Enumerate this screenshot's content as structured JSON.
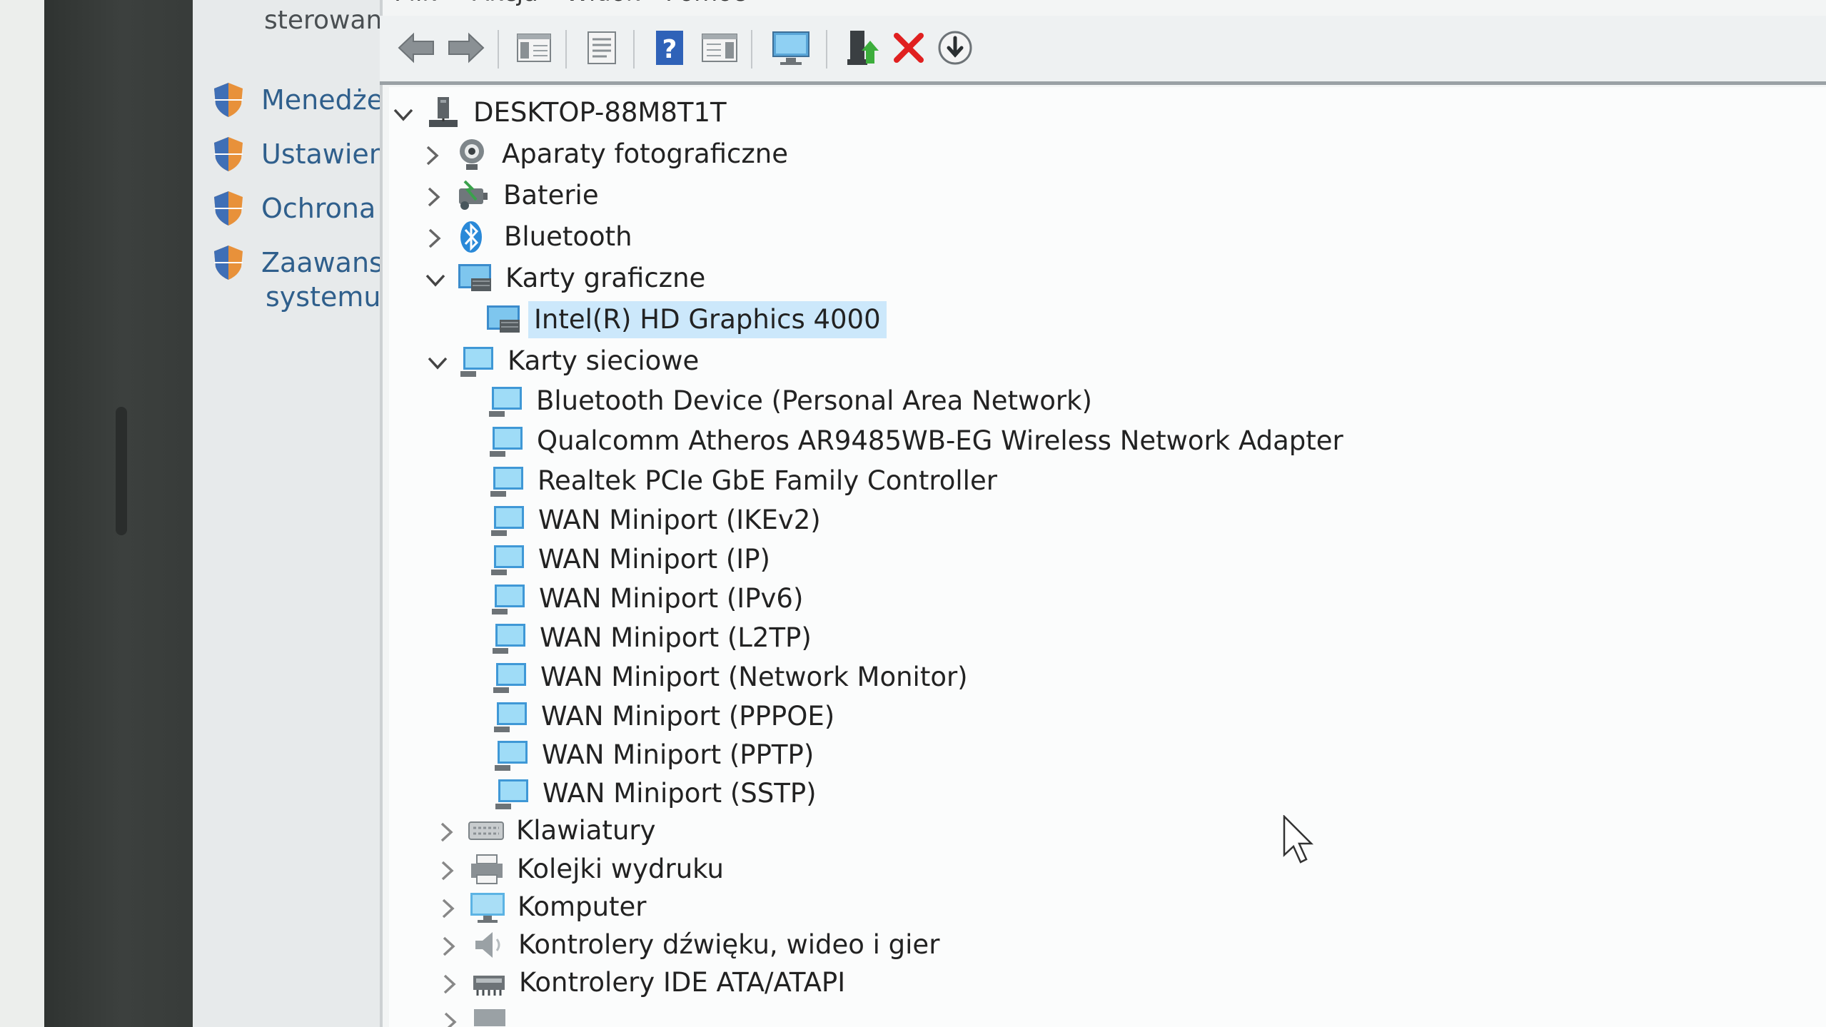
{
  "left_pane": {
    "top_label": "sterowan",
    "items": [
      {
        "label": "Menedże"
      },
      {
        "label": "Ustawien"
      },
      {
        "label": "Ochrona"
      },
      {
        "label": "Zaawanso",
        "label2": "systemu"
      }
    ]
  },
  "menu": {
    "items": [
      "Plik",
      "Akcja",
      "Widok",
      "Pomoc"
    ]
  },
  "toolbar": {
    "buttons": [
      "back-arrow-icon",
      "forward-arrow-icon",
      "show-hide-console-tree-icon",
      "properties-icon",
      "help-icon",
      "action-pane-icon",
      "scan-hardware-icon",
      "update-driver-icon",
      "uninstall-device-icon",
      "disable-device-icon"
    ]
  },
  "tree": {
    "root": "DESKTOP-88M8T1T",
    "categories": [
      {
        "label": "Aparaty fotograficzne",
        "expanded": false
      },
      {
        "label": "Baterie",
        "expanded": false
      },
      {
        "label": "Bluetooth",
        "expanded": false
      },
      {
        "label": "Karty graficzne",
        "expanded": true,
        "children": [
          "Intel(R) HD Graphics 4000"
        ]
      },
      {
        "label": "Karty sieciowe",
        "expanded": true,
        "children": [
          "Bluetooth Device (Personal Area Network)",
          "Qualcomm Atheros AR9485WB-EG Wireless Network Adapter",
          "Realtek PCIe GbE Family Controller",
          "WAN Miniport (IKEv2)",
          "WAN Miniport (IP)",
          "WAN Miniport (IPv6)",
          "WAN Miniport (L2TP)",
          "WAN Miniport (Network Monitor)",
          "WAN Miniport (PPPOE)",
          "WAN Miniport (PPTP)",
          "WAN Miniport (SSTP)"
        ]
      },
      {
        "label": "Klawiatury",
        "expanded": false
      },
      {
        "label": "Kolejki wydruku",
        "expanded": false
      },
      {
        "label": "Komputer",
        "expanded": false
      },
      {
        "label": "Kontrolery dźwięku, wideo i gier",
        "expanded": false
      },
      {
        "label": "Kontrolery IDE ATA/ATAPI",
        "expanded": false
      }
    ],
    "selected": "Intel(R) HD Graphics 4000"
  },
  "colors": {
    "selection": "#cce8fb",
    "link": "#2f5f8c",
    "shield_orange": "#e8913a",
    "shield_blue": "#3f6fb6",
    "delete_red": "#e02020"
  }
}
